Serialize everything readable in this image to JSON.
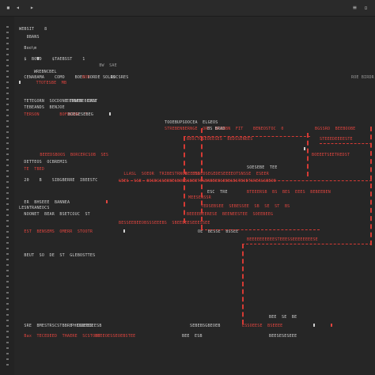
{
  "toolbar": {
    "icons": [
      "close-icon",
      "back-icon",
      "forward-icon",
      "menu-icon"
    ],
    "glyphs": [
      "▪",
      "◂",
      "▸",
      "≡",
      "▫"
    ]
  },
  "code": {
    "lines": [
      {
        "t": "WEBSIT    8",
        "c": "w"
      },
      {
        "t": "   8BANS",
        "c": "w"
      },
      {
        "t": "  Boo\\m",
        "c": "w"
      },
      {
        "t": "  $  BOWD    $TAEBSST    1",
        "c": "w"
      },
      {
        "t": "           BW  SAE",
        "c": "w"
      },
      {
        "t": "    WREBNCBEL",
        "c": "w"
      },
      {
        "t": "  CENABAMA    COMO    BOES BORDE SOLDS",
        "c": "w"
      },
      {
        "t": "   TTOTESBE  MB",
        "c": "r"
      },
      {
        "t": "  TETEGORN  SOCDONE TRWEB  CAST",
        "c": "w"
      },
      {
        "t": "  TEBEANDS  BENJOE",
        "c": "w"
      },
      {
        "t": "  TERSON        BOFDCROC  T",
        "c": "r"
      },
      {
        "t": "TOOEBUPSOOCEA  ELGEOS",
        "c": "w"
      },
      {
        "t": "STREBENBERNGE  ORT  BTEBBN  FIT",
        "c": "r"
      },
      {
        "t": "  BEEEDSBOOS  BORCERCSOB  SES",
        "c": "r"
      },
      {
        "t": "  DETTEOS  OCBREMIS",
        "c": "w"
      },
      {
        "t": "  TE  TBED",
        "c": "r"
      },
      {
        "t": "  LLASL  SOEOR  TRIBESTRNOR  EBS",
        "c": "r"
      },
      {
        "t": "     MEESENSSR",
        "c": "r"
      },
      {
        "t": "  20    B    SIBGBERRE  IBEESTC",
        "c": "w"
      },
      {
        "t": "  ER  BHSEEE  BANNEA",
        "c": "w"
      },
      {
        "t": "  NOONET  BEAR  BSETCOUC  ST",
        "c": "w"
      },
      {
        "t": "  EST  BENSEMS  OMERR  STOOTR",
        "c": "r"
      },
      {
        "t": "  BEUT  SO  DE  ST  GLEBOSTTES",
        "c": "w"
      },
      {
        "t": "  SRE  BMESTRSCSTBBRE  OSBTES",
        "c": "w"
      },
      {
        "t": "  Bax  TECEDEED  THAERE  SCSTOHT",
        "c": "r"
      }
    ]
  }
}
